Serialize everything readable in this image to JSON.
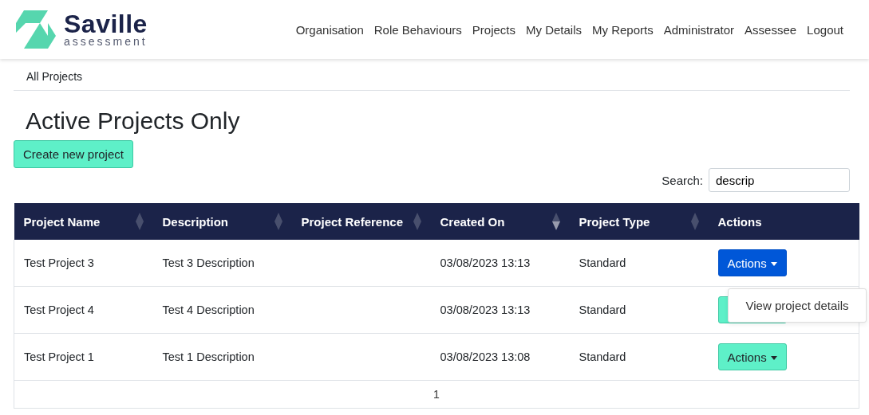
{
  "brand": {
    "name": "Saville",
    "tagline": "assessment"
  },
  "nav": [
    "Organisation",
    "Role Behaviours",
    "Projects",
    "My Details",
    "My Reports",
    "Administrator",
    "Assessee",
    "Logout"
  ],
  "breadcrumb": "All Projects",
  "heading": "Active Projects Only",
  "create_button": "Create new project",
  "search": {
    "label": "Search:",
    "value": "descrip"
  },
  "table": {
    "columns": [
      {
        "label": "Project Name",
        "sortable": true,
        "sorted": false
      },
      {
        "label": "Description",
        "sortable": true,
        "sorted": false
      },
      {
        "label": "Project Reference",
        "sortable": true,
        "sorted": false
      },
      {
        "label": "Created On",
        "sortable": true,
        "sorted": true
      },
      {
        "label": "Project Type",
        "sortable": true,
        "sorted": false
      },
      {
        "label": "Actions"
      }
    ],
    "rows": [
      {
        "cells": [
          "Test Project 3",
          "Test 3 Description",
          "",
          "03/08/2023 13:13",
          "Standard"
        ],
        "action": {
          "label": "Actions",
          "open": true,
          "menu": [
            "View project details"
          ]
        }
      },
      {
        "cells": [
          "Test Project 4",
          "Test 4 Description",
          "",
          "03/08/2023 13:13",
          "Standard"
        ],
        "action": {
          "open": false
        }
      },
      {
        "cells": [
          "Test Project 1",
          "Test 1 Description",
          "",
          "03/08/2023 13:08",
          "Standard"
        ],
        "action": {
          "label": "Actions",
          "open": false
        }
      }
    ]
  },
  "pagination": [
    {
      "label": "1",
      "selected": true
    }
  ]
}
